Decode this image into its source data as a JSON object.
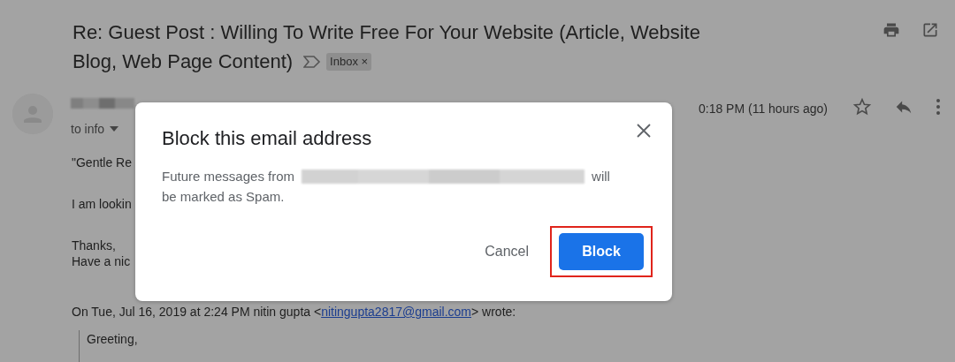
{
  "email": {
    "subject_lines": [
      "Re: Guest Post : Willing To Write Free For Your Website (Article, Website",
      "Blog, Web Page Content)"
    ],
    "label": {
      "text": "Inbox",
      "remove": "×"
    },
    "recipient": "to info",
    "time": "0:18 PM (11 hours ago)",
    "paragraphs": [
      {
        "lines": [
          "\"Gentle Re"
        ]
      },
      {
        "lines": [
          "I am lookin"
        ]
      },
      {
        "lines": [
          "Thanks,",
          "Have a nic"
        ]
      }
    ],
    "quote_header": {
      "prefix": "On Tue, Jul 16, 2019 at 2:24 PM nitin gupta <",
      "link": "nitingupta2817@gmail.com",
      "suffix": "> wrote:"
    },
    "quote_lines": [
      "Greeting,"
    ]
  },
  "dialog": {
    "title": "Block this email address",
    "message_start": "Future messages from",
    "message_mid": "will",
    "message_end": "be marked as Spam.",
    "buttons": [
      {
        "label": "Cancel",
        "kind": "text",
        "highlighted": false
      },
      {
        "label": "Block",
        "kind": "primary",
        "highlighted": true
      }
    ]
  }
}
